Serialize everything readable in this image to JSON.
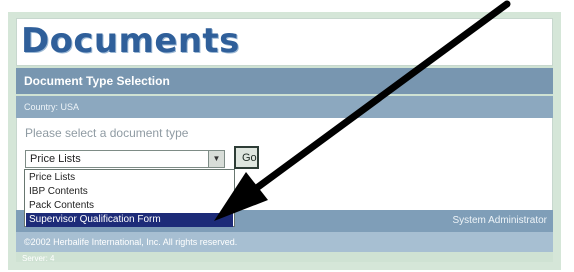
{
  "page": {
    "title": "Documents",
    "section_header": "Document Type Selection",
    "country": "Country: USA",
    "prompt": "Please select a document type"
  },
  "document_type_select": {
    "selected_value": "Price Lists",
    "options": [
      "Price Lists",
      "IBP Contents",
      "Pack Contents",
      "Supervisor Qualification Form"
    ],
    "highlighted_option": "Supervisor Qualification Form"
  },
  "actions": {
    "go_label": "Go"
  },
  "footer": {
    "user": "System Administrator",
    "copyright": "©2002 Herbalife International, Inc. All rights reserved.",
    "server": "Server: 4"
  },
  "annotation": {
    "icon": "arrow-pointer-icon",
    "color": "#000000"
  },
  "colors": {
    "title": "#2f5f9a",
    "section_bar": "#7896b0",
    "highlight": "#1d2b78"
  }
}
